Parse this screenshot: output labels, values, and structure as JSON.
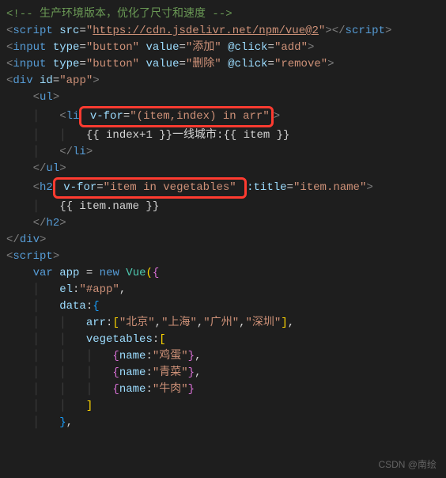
{
  "watermark": "CSDN @南绘",
  "code": {
    "comment": "<!-- 生产环境版本，优化了尺寸和速度 -->",
    "cdn_url": "https://cdn.jsdelivr.net/npm/vue@2",
    "btn1_value": "添加",
    "btn1_click": "add",
    "btn2_value": "删除",
    "btn2_click": "remove",
    "app_id": "app",
    "li_for": "(item,index) in arr",
    "li_text": "{{ index+1 }}一线城市:{{ item }}",
    "h2_for": "item in vegetables",
    "h2_title": "item.name",
    "h2_text": "{{ item.name }}",
    "var_name": "app",
    "el_val": "#app",
    "arr_items": "[\"北京\",\"上海\",\"广州\",\"深圳\"]",
    "veg1": "鸡蛋",
    "veg2": "青菜",
    "veg3": "牛肉"
  }
}
